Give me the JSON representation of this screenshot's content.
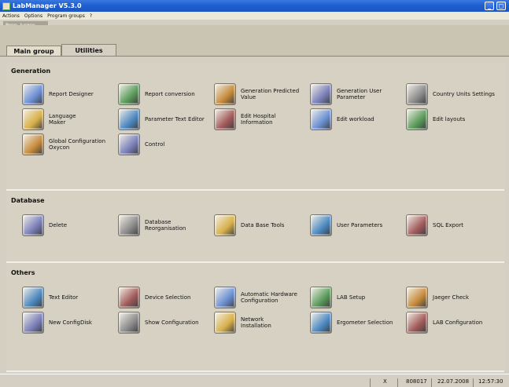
{
  "window": {
    "title": "LabManager V5.3.0"
  },
  "menu": [
    "Actions",
    "Options",
    "Program groups",
    "?"
  ],
  "user": "Popp, Jurgen",
  "tabs": [
    "Main group",
    "Utilities"
  ],
  "colors": {
    "title_bar": "#1f5fcf",
    "panel": "#d6d1c3",
    "accent_blue": "#2e6bd6"
  },
  "sections": [
    {
      "title": "Generation",
      "items": [
        {
          "label": "Report Designer",
          "icon": "report-designer-icon"
        },
        {
          "label": "Report conversion",
          "icon": "report-conversion-icon"
        },
        {
          "label": "Generation Predicted\nValue",
          "icon": "generation-predicted-icon"
        },
        {
          "label": "Generation User\nParameter",
          "icon": "generation-user-icon"
        },
        {
          "label": "Country Units Settings",
          "icon": "country-units-icon"
        },
        {
          "label": "Language\nMaker",
          "icon": "globe-icon"
        },
        {
          "label": "Parameter Text Editor",
          "icon": "parameter-text-icon"
        },
        {
          "label": "Edit Hospital\nInformation",
          "icon": "hospital-icon"
        },
        {
          "label": "Edit workload",
          "icon": "workload-icon"
        },
        {
          "label": "Edit layouts",
          "icon": "layouts-icon"
        },
        {
          "label": "Global Configuration\nOxycon",
          "icon": "tools-icon"
        },
        {
          "label": "Control",
          "icon": "windows-icon"
        }
      ]
    },
    {
      "title": "Database",
      "items": [
        {
          "label": "Delete",
          "icon": "delete-icon"
        },
        {
          "label": "Database\nReorganisation",
          "icon": "database-reorg-icon"
        },
        {
          "label": "Data Base Tools",
          "icon": "database-tools-icon"
        },
        {
          "label": "User Parameters",
          "icon": "user-parameters-icon"
        },
        {
          "label": "SQL Export",
          "icon": "sql-export-icon"
        }
      ]
    },
    {
      "title": "Others",
      "items": [
        {
          "label": "Text Editor",
          "icon": "text-editor-icon"
        },
        {
          "label": "Device Selection",
          "icon": "device-selection-icon"
        },
        {
          "label": "Automatic Hardware\nConfiguration",
          "icon": "hardware-config-icon"
        },
        {
          "label": "LAB Setup",
          "icon": "lab-setup-icon"
        },
        {
          "label": "Jaeger Check",
          "icon": "jaeger-check-icon"
        },
        {
          "label": "New ConfigDisk",
          "icon": "config-disk-icon"
        },
        {
          "label": "Show Configuration",
          "icon": "show-config-icon"
        },
        {
          "label": "Network\nInstallation",
          "icon": "network-install-icon"
        },
        {
          "label": "Ergometer Selection",
          "icon": "ergometer-icon"
        },
        {
          "label": "LAB Configuration",
          "icon": "lab-config-icon"
        }
      ]
    }
  ],
  "status": {
    "mode": "X",
    "id": "808017",
    "date": "22.07.2008",
    "time": "12:57:30"
  }
}
